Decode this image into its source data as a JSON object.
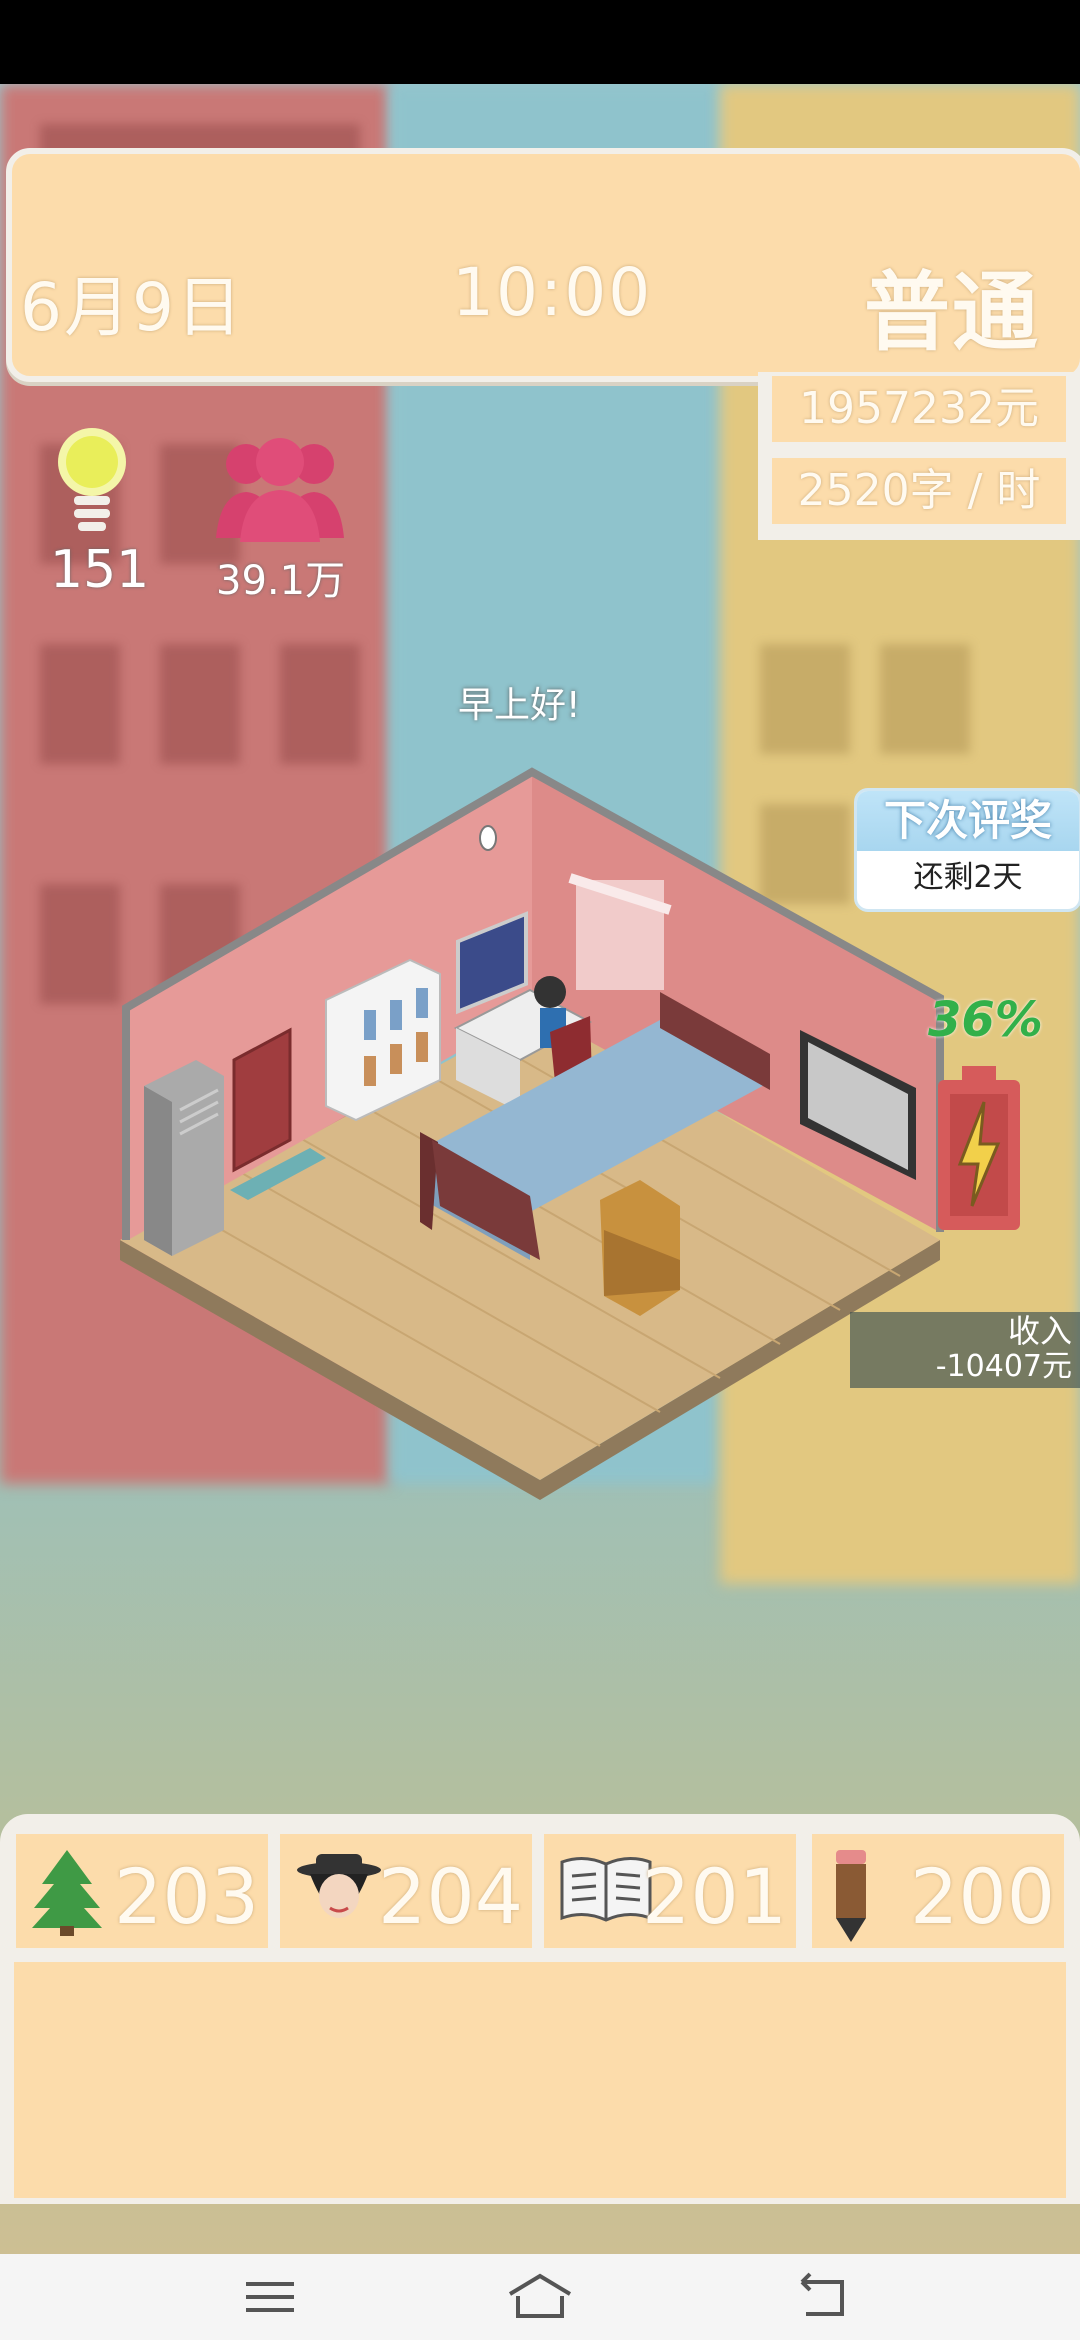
{
  "header": {
    "date": "6月9日",
    "time": "10:00",
    "difficulty": "普通"
  },
  "finance": {
    "money": "1957232元",
    "writing_speed": "2520字 / 时"
  },
  "stats": {
    "inspiration": "151",
    "fans": "39.1万"
  },
  "greeting": "早上好!",
  "award": {
    "title": "下次评奖",
    "remaining": "还剩2天"
  },
  "energy": {
    "percent": "36%",
    "level": 0.36
  },
  "income": {
    "label": "收入",
    "value": "-10407元"
  },
  "skills": [
    {
      "icon": "tree-icon",
      "value": "203"
    },
    {
      "icon": "character-hat-icon",
      "value": "204"
    },
    {
      "icon": "open-book-icon",
      "value": "201"
    },
    {
      "icon": "pencil-icon",
      "value": "200"
    }
  ],
  "nav": [
    "menu-icon",
    "home-icon",
    "back-icon"
  ],
  "colors": {
    "panel": "#fcdcab",
    "panel_border": "#f2efe9",
    "energy_green": "#32b04a",
    "battery_red": "#d65b5b",
    "fans_pink": "#d6416e",
    "bulb_yellow": "#e9ee5a"
  }
}
